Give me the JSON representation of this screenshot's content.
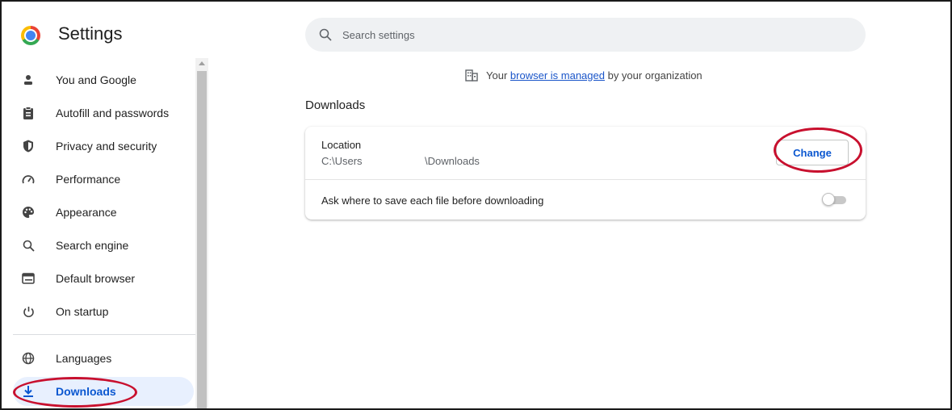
{
  "app": {
    "title": "Settings"
  },
  "sidebar": {
    "items": [
      {
        "label": "You and Google",
        "icon": "person-icon"
      },
      {
        "label": "Autofill and passwords",
        "icon": "clipboard-icon"
      },
      {
        "label": "Privacy and security",
        "icon": "shield-icon"
      },
      {
        "label": "Performance",
        "icon": "speedometer-icon"
      },
      {
        "label": "Appearance",
        "icon": "palette-icon"
      },
      {
        "label": "Search engine",
        "icon": "search-icon"
      },
      {
        "label": "Default browser",
        "icon": "browser-window-icon"
      },
      {
        "label": "On startup",
        "icon": "power-icon"
      },
      {
        "label": "Languages",
        "icon": "globe-icon"
      },
      {
        "label": "Downloads",
        "icon": "download-icon",
        "active": true
      }
    ]
  },
  "search": {
    "placeholder": "Search settings",
    "value": ""
  },
  "managed_notice": {
    "prefix": "Your",
    "link": "browser is managed",
    "suffix": "by your organization"
  },
  "downloads": {
    "section_title": "Downloads",
    "location_label": "Location",
    "location_path_start": "C:\\Users",
    "location_path_end": "\\Downloads",
    "change_button": "Change",
    "ask_label": "Ask where to save each file before downloading",
    "ask_enabled": false
  },
  "colors": {
    "accent": "#0b57d0",
    "active_bg": "#e8f0fe",
    "annotation": "#c8102e"
  }
}
